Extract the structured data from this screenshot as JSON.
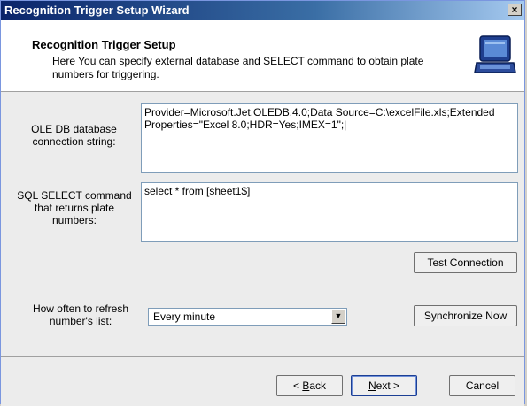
{
  "window": {
    "title": "Recognition Trigger Setup Wizard",
    "close_label": "×"
  },
  "header": {
    "title": "Recognition Trigger Setup",
    "description": "Here You can specify external database and SELECT command to obtain plate numbers for triggering."
  },
  "form": {
    "connection_label": "OLE DB database connection string:",
    "connection_value": "Provider=Microsoft.Jet.OLEDB.4.0;Data Source=C:\\excelFile.xls;Extended Properties=\"Excel 8.0;HDR=Yes;IMEX=1\";|",
    "sql_label": "SQL SELECT command that returns plate numbers:",
    "sql_value": "select * from [sheet1$]",
    "test_button": "Test Connection",
    "refresh_label": "How often to refresh number's list:",
    "refresh_value": "Every minute",
    "sync_button": "Synchronize Now"
  },
  "footer": {
    "back_prefix": "< ",
    "back_accel": "B",
    "back_rest": "ack",
    "next_accel": "N",
    "next_rest": "ext >",
    "cancel": "Cancel"
  },
  "icons": {
    "wizard": "laptop-icon",
    "dropdown": "chevron-down-icon"
  }
}
